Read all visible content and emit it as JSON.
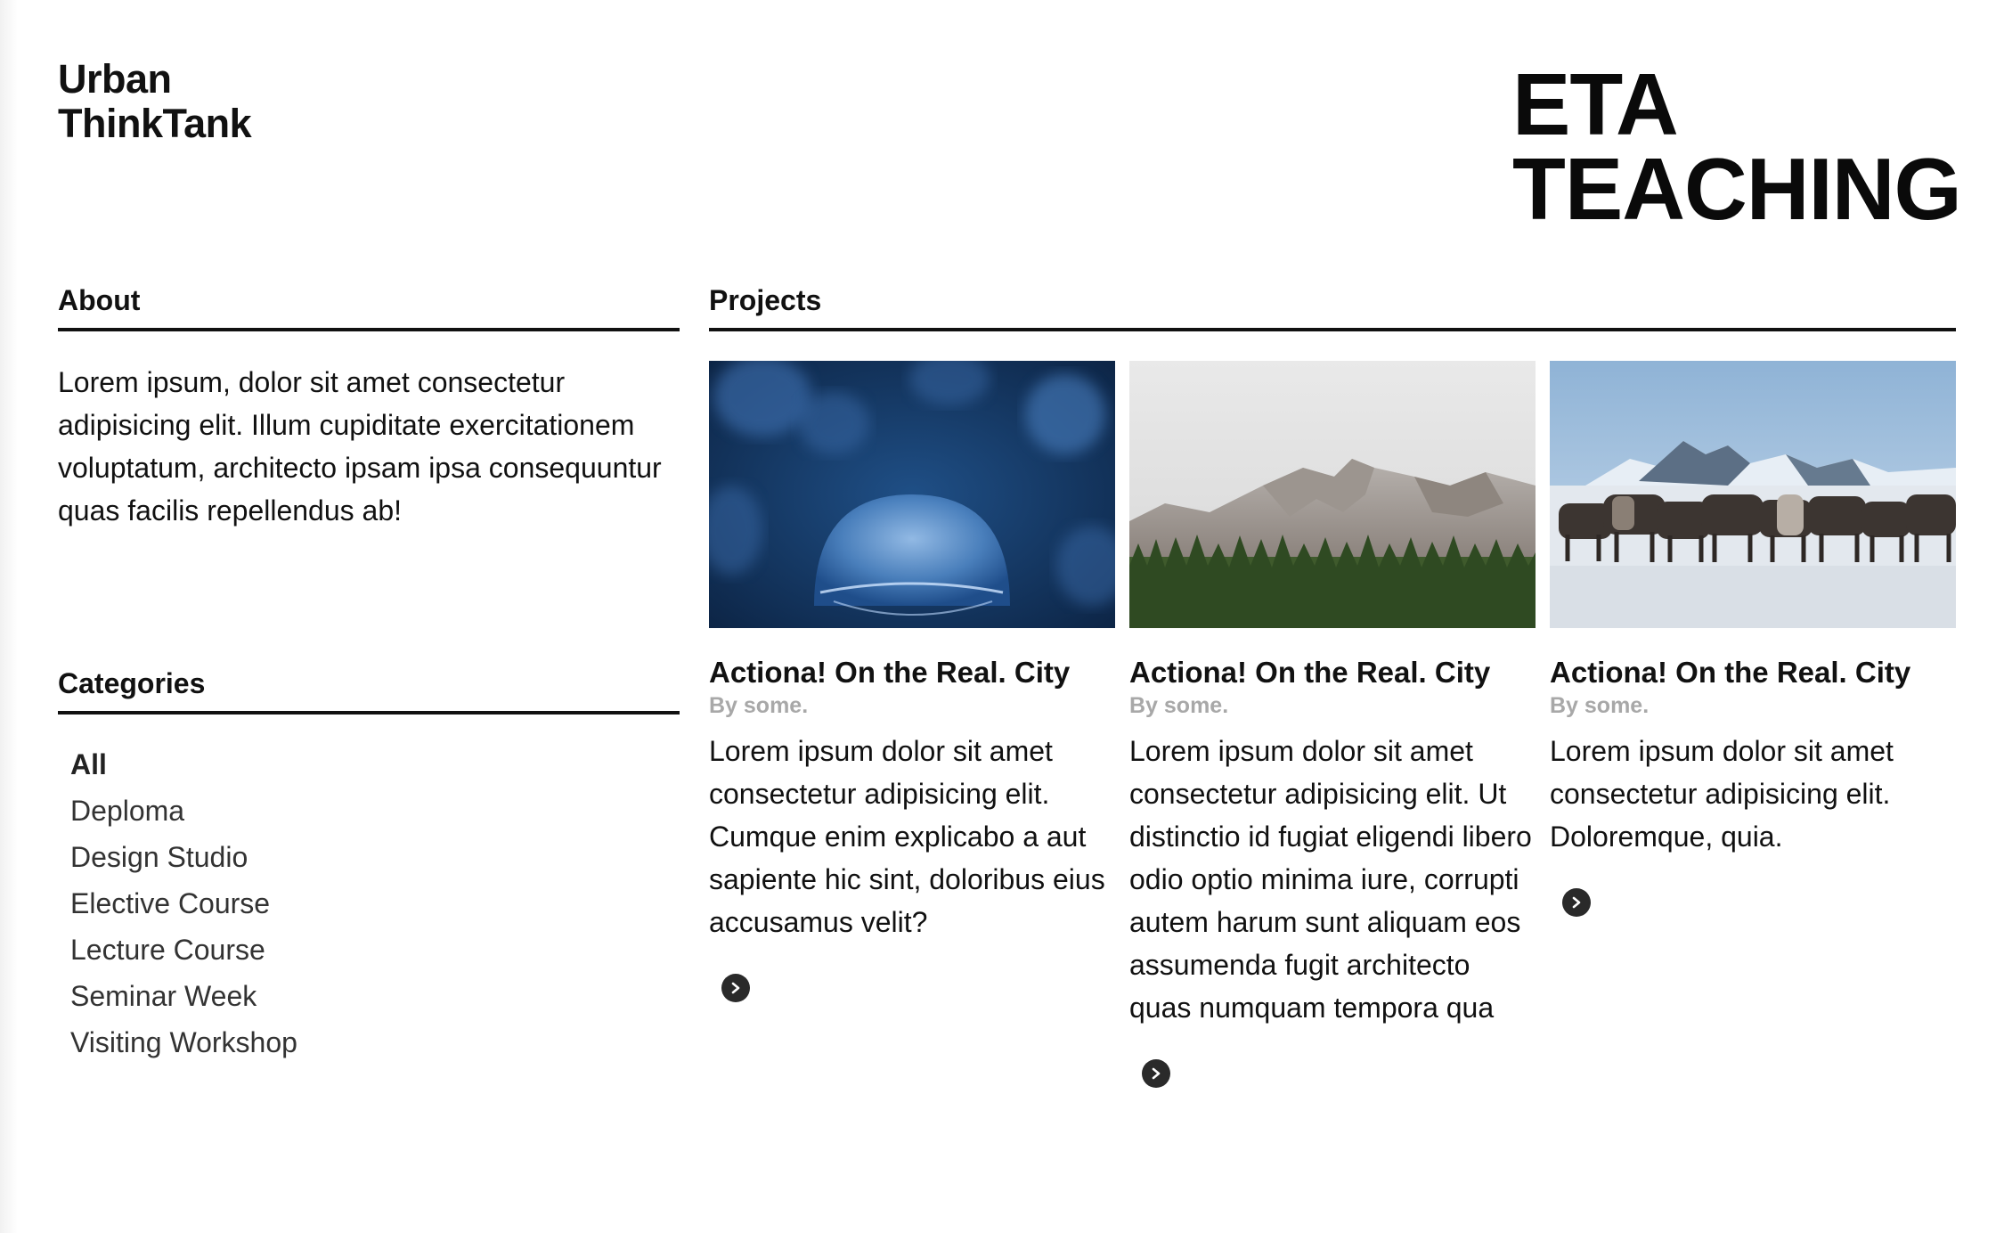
{
  "brand": {
    "line1": "Urban",
    "line2": "ThinkTank"
  },
  "hero": {
    "line1": "ETA",
    "line2": "TEACHING"
  },
  "about": {
    "heading": "About",
    "text": "Lorem ipsum, dolor sit amet consectetur adipisicing elit. Illum cupiditate exercitationem voluptatum, architecto ipsam ipsa consequuntur quas facilis repellendus ab!"
  },
  "categories": {
    "heading": "Categories",
    "items": [
      {
        "label": "All",
        "active": true
      },
      {
        "label": "Deploma"
      },
      {
        "label": "Design Studio"
      },
      {
        "label": "Elective Course"
      },
      {
        "label": "Lecture Course"
      },
      {
        "label": "Seminar Week"
      },
      {
        "label": "Visiting Workshop"
      }
    ]
  },
  "projects": {
    "heading": "Projects",
    "cards": [
      {
        "image": "jellyfish-photo",
        "title": "Actiona! On the Real. City",
        "byline": "By some.",
        "text": "Lorem ipsum dolor sit amet consectetur adipisicing elit. Cumque enim explicabo a aut sapiente hic sint, doloribus eius accusamus velit?",
        "more_icon": "chevron-right-circle-icon"
      },
      {
        "image": "mountain-forest-photo",
        "title": "Actiona! On the Real. City",
        "byline": "By some.",
        "text": "Lorem ipsum dolor sit amet consectetur adipisicing elit. Ut distinctio id fugiat eligendi libero odio optio minima iure, corrupti autem harum sunt aliquam eos assumenda fugit architecto quas numquam tempora qua",
        "more_icon": "chevron-right-circle-icon"
      },
      {
        "image": "horses-snow-photo",
        "title": "Actiona! On the Real. City",
        "byline": "By some.",
        "text": "Lorem ipsum dolor sit amet consectetur adipisicing elit. Doloremque, quia.",
        "more_icon": "chevron-right-circle-icon"
      }
    ]
  },
  "colors": {
    "text": "#111111",
    "muted": "#a8a8a8",
    "icon_bg": "#2a2a2a"
  }
}
